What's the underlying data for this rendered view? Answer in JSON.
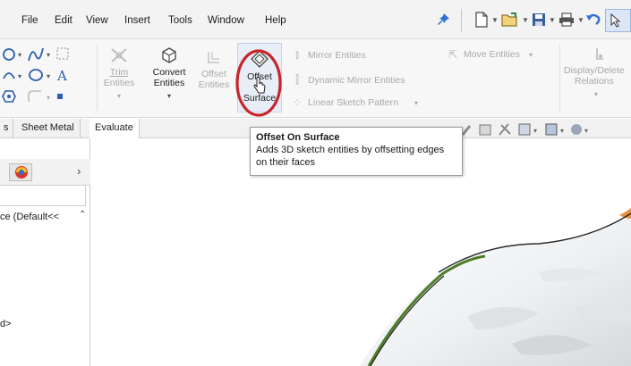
{
  "menu": {
    "items": [
      "File",
      "Edit",
      "View",
      "Insert",
      "Tools",
      "Window",
      "Help"
    ]
  },
  "ribbon": {
    "trim": {
      "line1": "Trim",
      "line2": "Entities"
    },
    "convert": {
      "line1": "Convert",
      "line2": "Entities"
    },
    "offset_entities": {
      "line1": "Offset",
      "line2": "Entities"
    },
    "offset_surface": {
      "line1": "Offset",
      "line2": "Surface"
    },
    "mirror": "Mirror Entities",
    "dynamic_mirror": "Dynamic Mirror Entities",
    "linear_pattern": "Linear Sketch Pattern",
    "move": "Move Entities",
    "display_delete": {
      "line1": "Display/Delete",
      "line2": "Relations"
    }
  },
  "tabs": [
    "s",
    "Sheet Metal",
    "Evaluate"
  ],
  "left_panel": {
    "tree_item": "ce  (Default<<",
    "tree_item2": "d>"
  },
  "tooltip": {
    "title": "Offset On Surface",
    "description": "Adds 3D sketch entities by offsetting edges on their faces"
  },
  "colors": {
    "highlight_circle": "#c8242b",
    "pin": "#2f6fd6",
    "surface_green": "#4d7d2a",
    "surface_orange": "#e8923a"
  }
}
